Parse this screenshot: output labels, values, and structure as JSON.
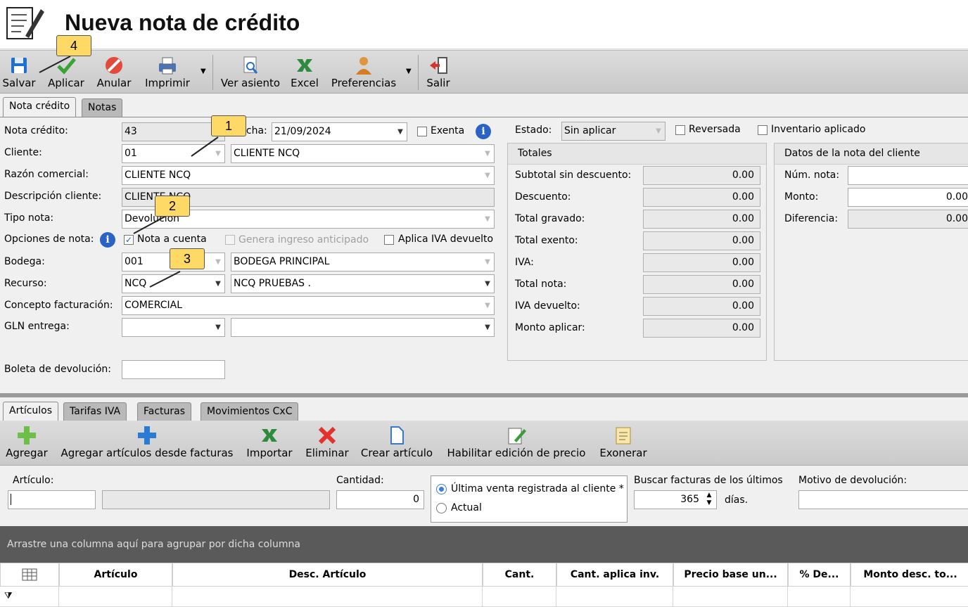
{
  "window": {
    "title": "Nueva nota de crédito"
  },
  "toolbar": {
    "save": "Salvar",
    "apply": "Aplicar",
    "cancel": "Anular",
    "print": "Imprimir",
    "view_entry": "Ver asiento",
    "excel": "Excel",
    "preferences": "Preferencias",
    "exit": "Salir"
  },
  "tabs": {
    "credit_note": "Nota crédito",
    "notes": "Notas"
  },
  "form": {
    "credit_note_label": "Nota crédito:",
    "credit_note_value": "43",
    "date_label": "Fecha:",
    "date_value": "21/09/2024",
    "exempt_label": "Exenta",
    "client_label": "Cliente:",
    "client_code": "01",
    "client_name": "CLIENTE NCQ",
    "trade_name_label": "Razón comercial:",
    "trade_name_value": "CLIENTE NCQ",
    "client_desc_label": "Descripción cliente:",
    "client_desc_value": "CLIENTE NCQ",
    "note_type_label": "Tipo nota:",
    "note_type_value": "Devolución",
    "options_label": "Opciones de nota:",
    "on_account_label": "Nota a cuenta",
    "advance_income_label": "Genera ingreso anticipado",
    "vat_refund_label": "Aplica IVA devuelto",
    "warehouse_label": "Bodega:",
    "warehouse_code": "001",
    "warehouse_name": "BODEGA PRINCIPAL",
    "resource_label": "Recurso:",
    "resource_code": "NCQ",
    "resource_name": "NCQ PRUEBAS .",
    "billing_concept_label": "Concepto facturación:",
    "billing_concept_value": "COMERCIAL",
    "gln_label": "GLN entrega:",
    "return_slip_label": "Boleta de devolución:"
  },
  "status": {
    "label": "Estado:",
    "value": "Sin aplicar",
    "reversed_label": "Reversada",
    "inventory_applied_label": "Inventario aplicado"
  },
  "totals": {
    "title": "Totales",
    "rows": [
      {
        "label": "Subtotal sin descuento:",
        "value": "0.00"
      },
      {
        "label": "Descuento:",
        "value": "0.00"
      },
      {
        "label": "Total gravado:",
        "value": "0.00"
      },
      {
        "label": "Total exento:",
        "value": "0.00"
      },
      {
        "label": "IVA:",
        "value": "0.00"
      },
      {
        "label": "Total nota:",
        "value": "0.00"
      },
      {
        "label": "IVA devuelto:",
        "value": "0.00"
      },
      {
        "label": "Monto aplicar:",
        "value": "0.00"
      }
    ]
  },
  "client_note": {
    "title": "Datos de la nota del cliente",
    "num_label": "Núm. nota:",
    "amount_label": "Monto:",
    "amount_value": "0.00",
    "diff_label": "Diferencia:",
    "diff_value": "0.00"
  },
  "callouts": {
    "c1": "1",
    "c2": "2",
    "c3": "3",
    "c4": "4"
  },
  "bottom_tabs": {
    "articles": "Artículos",
    "vat_rates": "Tarifas IVA",
    "invoices": "Facturas",
    "ar_movements": "Movimientos CxC"
  },
  "toolbar2": {
    "add": "Agregar",
    "add_from_invoices": "Agregar artículos desde facturas",
    "import": "Importar",
    "delete": "Eliminar",
    "create_article": "Crear artículo",
    "enable_price_edit": "Habilitar edición de precio",
    "exonerate": "Exonerar"
  },
  "entry": {
    "article_label": "Artículo:",
    "quantity_label": "Cantidad:",
    "quantity_value": "0",
    "last_sale_label": "Última venta registrada al cliente *",
    "current_label": "Actual",
    "search_invoices_label": "Buscar facturas  de los últimos",
    "days_value": "365",
    "days_label": "días.",
    "return_reason_label": "Motivo de devolución:"
  },
  "grid": {
    "group_hint": "Arrastre una columna aquí para agrupar por dicha columna",
    "columns": [
      "Artículo",
      "Desc. Artículo",
      "Cant.",
      "Cant. aplica inv.",
      "Precio base un...",
      "% De...",
      "Monto desc. to..."
    ]
  }
}
